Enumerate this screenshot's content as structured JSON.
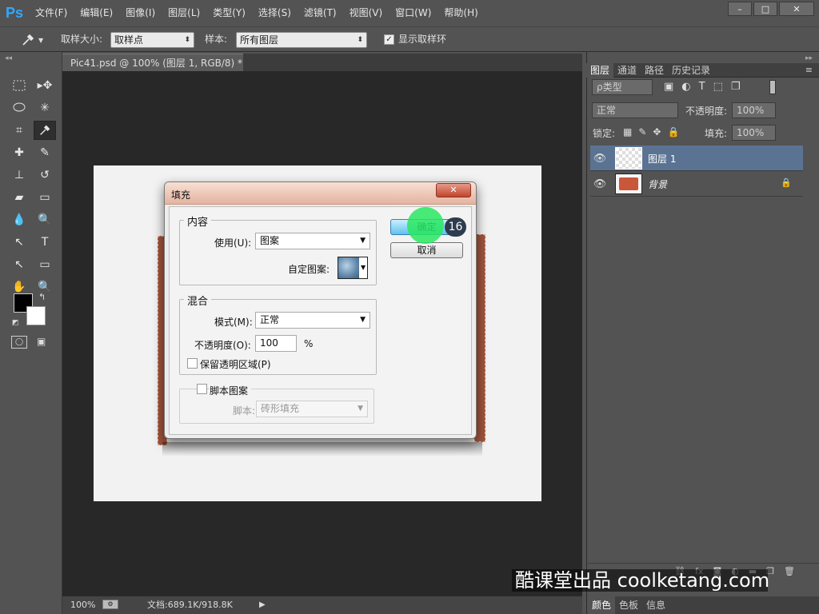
{
  "app": {
    "logo": "Ps",
    "menus": [
      "文件(F)",
      "编辑(E)",
      "图像(I)",
      "图层(L)",
      "类型(Y)",
      "选择(S)",
      "滤镜(T)",
      "视图(V)",
      "窗口(W)",
      "帮助(H)"
    ],
    "window_controls": [
      "–",
      "□",
      "✕"
    ]
  },
  "options_bar": {
    "sample_size_label": "取样大小:",
    "sample_size_value": "取样点",
    "sample_label": "样本:",
    "sample_value": "所有图层",
    "show_ring_label": "显示取样环",
    "show_ring_checked": true
  },
  "toolbar": {
    "tools": [
      "rect-marquee-icon",
      "move-icon",
      "lasso-icon",
      "magic-wand-icon",
      "crop-icon",
      "eyedropper-icon",
      "healing-icon",
      "brush-icon",
      "stamp-icon",
      "history-brush-icon",
      "eraser-icon",
      "gradient-icon",
      "blur-icon",
      "dodge-icon",
      "path-select-icon",
      "type-icon",
      "direct-select-icon",
      "shape-icon",
      "hand-icon",
      "zoom-icon"
    ]
  },
  "document": {
    "tab_label": "Pic41.psd @ 100% (图层 1, RGB/8) *",
    "tab_close": "×",
    "zoom": "100%",
    "doc_info": "文档:689.1K/918.8K"
  },
  "dialog": {
    "title": "填充",
    "close": "✕",
    "content_group": "内容",
    "use_label": "使用(U):",
    "use_value": "图案",
    "custom_pattern_label": "自定图案:",
    "blend_group": "混合",
    "mode_label": "模式(M):",
    "mode_value": "正常",
    "opacity_label": "不透明度(O):",
    "opacity_value": "100",
    "opacity_unit": "%",
    "preserve_label": "保留透明区域(P)",
    "preserve_checked": false,
    "script_label": "脚本图案",
    "script_checked": false,
    "script_field_label": "脚本:",
    "script_value": "砖形填充",
    "ok": "确定",
    "cancel": "取消"
  },
  "step_marker": "16",
  "layers_panel": {
    "tabs": [
      "图层",
      "通道",
      "路径",
      "历史记录"
    ],
    "filter_value": "ρ类型",
    "blend_mode": "正常",
    "opacity_label": "不透明度:",
    "opacity_value": "100%",
    "lock_label": "锁定:",
    "fill_label": "填充:",
    "fill_value": "100%",
    "layers": [
      {
        "name": "图层 1",
        "selected": true
      },
      {
        "name": "背景",
        "selected": false,
        "locked": true
      }
    ],
    "bottom_tabs": [
      "颜色",
      "色板",
      "信息"
    ]
  },
  "watermark": "酷课堂出品 coolketang.com",
  "colors": {
    "accent_blue": "#31a8ff",
    "selected_layer": "#5b7393",
    "marker_green": "#2ee860"
  }
}
